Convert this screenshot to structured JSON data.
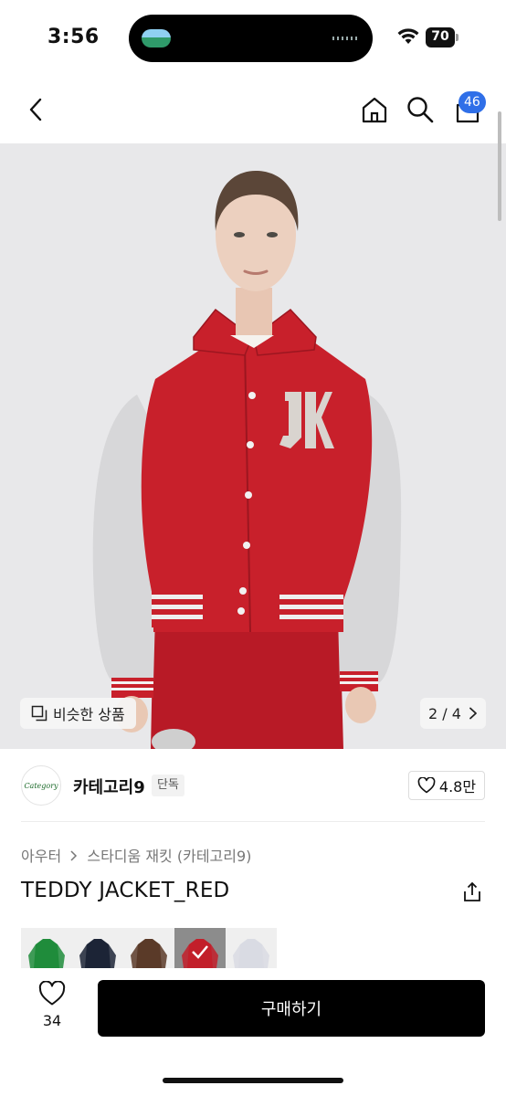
{
  "status_bar": {
    "time": "3:56",
    "battery": "70"
  },
  "nav": {
    "back_icon": "chevron-left-icon",
    "home_icon": "home-icon",
    "search_icon": "search-icon",
    "cart_icon": "shopping-bag-icon",
    "cart_count": "46"
  },
  "hero": {
    "similar_label": "비슷한 상품",
    "page_current": "2",
    "page_total": "4",
    "page_text": "2 / 4"
  },
  "brand": {
    "logo_text": "Category",
    "name": "카테고리9",
    "tag": "단독",
    "likes": "4.8만"
  },
  "product": {
    "breadcrumb": [
      "아우터",
      "스타디움 재킷 (카테고리9)"
    ],
    "title": "TEDDY JACKET_RED",
    "color_thumbs": [
      {
        "color": "#1f8c3b",
        "selected": false
      },
      {
        "color": "#1c2436",
        "selected": false
      },
      {
        "color": "#5a3a28",
        "selected": false
      },
      {
        "color": "#c21f2a",
        "selected": true
      },
      {
        "color": "#d9dbe3",
        "selected": false
      }
    ]
  },
  "bottom_bar": {
    "wish_count": "34",
    "buy_label": "구매하기"
  },
  "colors": {
    "accent_badge": "#2f6fe8",
    "buy_button": "#000000",
    "jacket_red": "#c8202b",
    "sleeve_gray": "#d6d6d8"
  }
}
